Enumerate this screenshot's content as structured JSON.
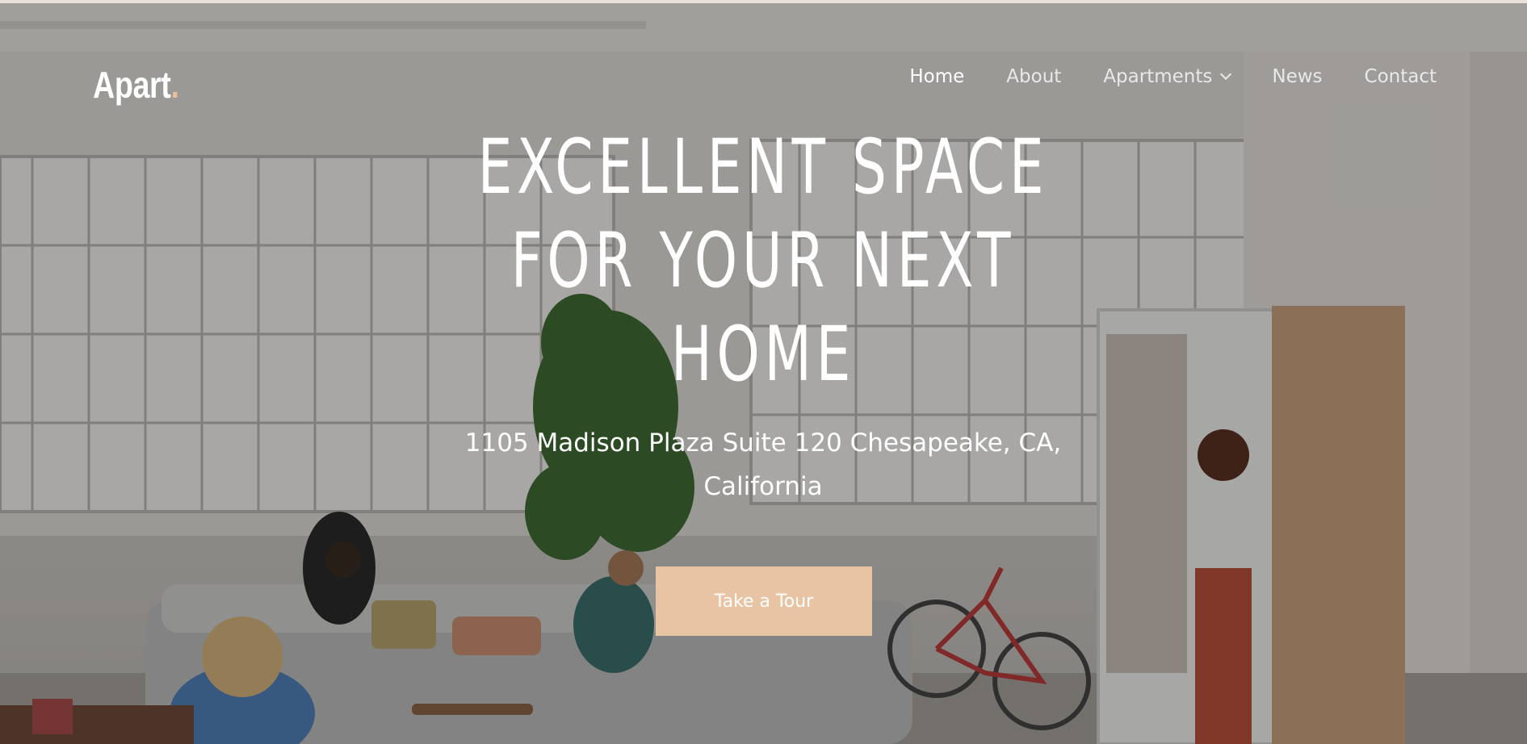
{
  "brand": {
    "logo_text": "Apart",
    "logo_dot": ".",
    "accent_color": "#e8bf9b"
  },
  "nav": {
    "items": [
      {
        "label": "Home",
        "active": true
      },
      {
        "label": "About",
        "active": false
      },
      {
        "label": "Apartments",
        "active": false,
        "has_dropdown": true
      },
      {
        "label": "News",
        "active": false
      },
      {
        "label": "Contact",
        "active": false
      }
    ]
  },
  "hero": {
    "headline_lines": [
      "EXCELLENT SPACE",
      "FOR YOUR NEXT",
      "HOME"
    ],
    "address_lines": [
      "1105 Madison Plaza Suite 120 Chesapeake, CA,",
      "California"
    ],
    "cta_label": "Take a Tour",
    "cta_color": "#e8c3a4"
  }
}
